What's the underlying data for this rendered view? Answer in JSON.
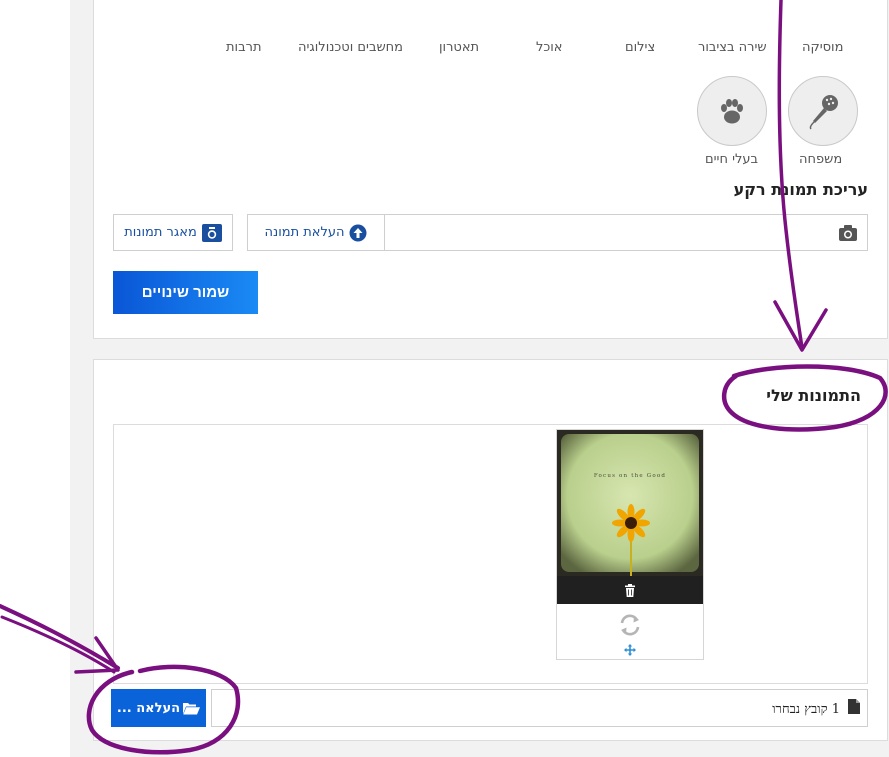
{
  "categories": [
    "מוסיקה",
    "שירה בציבור",
    "צילום",
    "אוכל",
    "תאטרון",
    "מחשבים וטכנולוגיה",
    "תרבות"
  ],
  "circles": [
    {
      "label": "משפחה",
      "icon": "microphone-icon"
    },
    {
      "label": "בעלי חיים",
      "icon": "paw-icon"
    }
  ],
  "background_section": {
    "title": "עריכת תמונת רקע",
    "upload_label": "העלאת תמונה",
    "gallery_label": "מאגר תמונות"
  },
  "save_label": "שמור שינויים",
  "my_photos": {
    "title": "התמונות שלי",
    "photo_caption": "Focus on the Good"
  },
  "file_upload": {
    "status": "1 קובץ נבחרו",
    "button_label": "העלאה ..."
  },
  "colors": {
    "primary": "#0a63d8",
    "annotation": "#7a0f80"
  }
}
